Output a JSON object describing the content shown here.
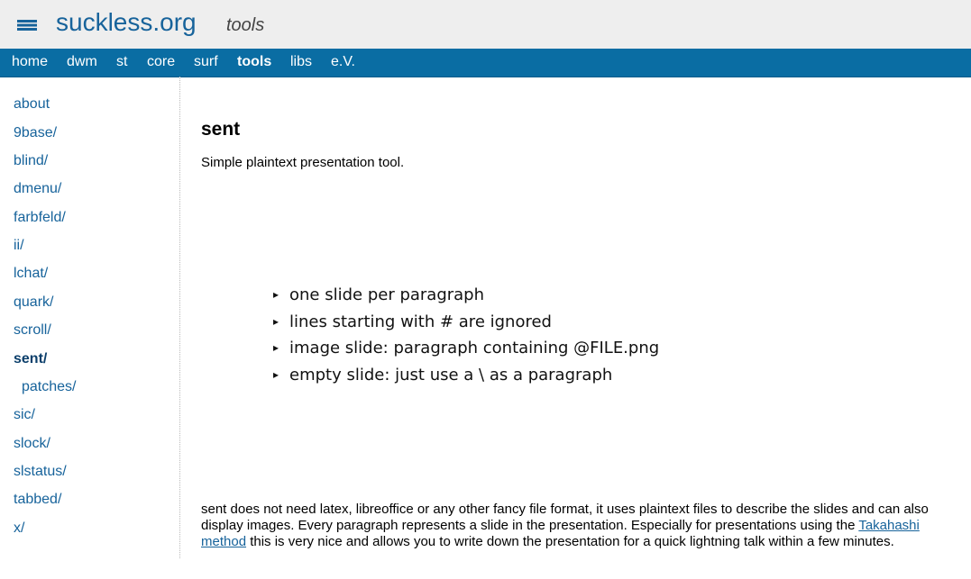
{
  "header": {
    "logo_text": "suckless.org",
    "section": "tools",
    "logo_icon": "stacked-bars-icon",
    "accent_color": "#17639b"
  },
  "nav": {
    "bar_color": "#0a6da3",
    "items": [
      {
        "label": "home",
        "active": false
      },
      {
        "label": "dwm",
        "active": false
      },
      {
        "label": "st",
        "active": false
      },
      {
        "label": "core",
        "active": false
      },
      {
        "label": "surf",
        "active": false
      },
      {
        "label": "tools",
        "active": true
      },
      {
        "label": "libs",
        "active": false
      },
      {
        "label": "e.V.",
        "active": false
      }
    ]
  },
  "sidebar": {
    "items": [
      {
        "label": "about",
        "active": false
      },
      {
        "label": "9base/",
        "active": false
      },
      {
        "label": "blind/",
        "active": false
      },
      {
        "label": "dmenu/",
        "active": false
      },
      {
        "label": "farbfeld/",
        "active": false
      },
      {
        "label": "ii/",
        "active": false
      },
      {
        "label": "lchat/",
        "active": false
      },
      {
        "label": "quark/",
        "active": false
      },
      {
        "label": "scroll/",
        "active": false
      },
      {
        "label": "sent/",
        "active": true
      },
      {
        "label": "patches/",
        "active": false,
        "sub": true
      },
      {
        "label": "sic/",
        "active": false
      },
      {
        "label": "slock/",
        "active": false
      },
      {
        "label": "slstatus/",
        "active": false
      },
      {
        "label": "tabbed/",
        "active": false
      },
      {
        "label": "x/",
        "active": false
      }
    ]
  },
  "main": {
    "title": "sent",
    "description": "Simple plaintext presentation tool.",
    "slide_items": [
      "one slide per paragraph",
      "lines starting with # are ignored",
      "image slide: paragraph containing @FILE.png",
      "empty slide: just use a \\ as a paragraph"
    ],
    "bullet_glyph": "▸",
    "body_before_link": "sent does not need latex, libreoffice or any other fancy file format, it uses plaintext files to describe the slides and can also display images. Every paragraph represents a slide in the presentation. Especially for presentations using the ",
    "link_text": "Takahashi method",
    "body_after_link": " this is very nice and allows you to write down the presentation for a quick lightning talk within a few minutes."
  }
}
